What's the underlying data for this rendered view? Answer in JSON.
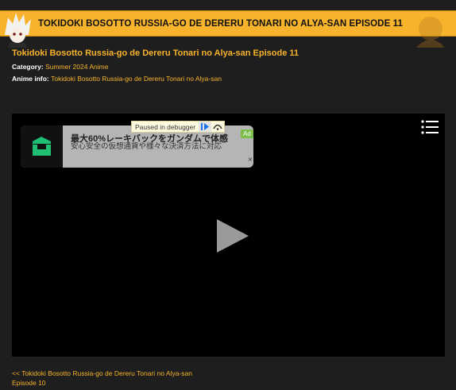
{
  "header": {
    "title": "TOKIDOKI BOSOTTO RUSSIA-GO DE DERERU TONARI NO ALYA-SAN EPISODE 11"
  },
  "post": {
    "title": "Tokidoki Bosotto Russia-go de Dereru Tonari no Alya-san Episode 11",
    "category_label": "Category:",
    "category_value": "Summer 2024 Anime",
    "anime_info_label": "Anime info:",
    "anime_info_value": "Tokidoki Bosotto Russia-go de Dereru Tonari no Alya-san"
  },
  "ad": {
    "headline": "最大60%レーキバックをガンダムで体感",
    "body": "安心安全の仮想通貨や様々な決済方法に対応",
    "badge": "Ad",
    "close": "×"
  },
  "debugger": {
    "text": "Paused in debugger"
  },
  "navigation": {
    "prev_episode": "<< Tokidoki Bosotto Russia-go de Dereru Tonari no Alya-san Episode 10"
  },
  "colors": {
    "accent": "#f7b32b",
    "background": "#1e1e1e",
    "player": "#000000"
  },
  "icons": {
    "menu": "menu-icon",
    "play": "play-icon"
  }
}
